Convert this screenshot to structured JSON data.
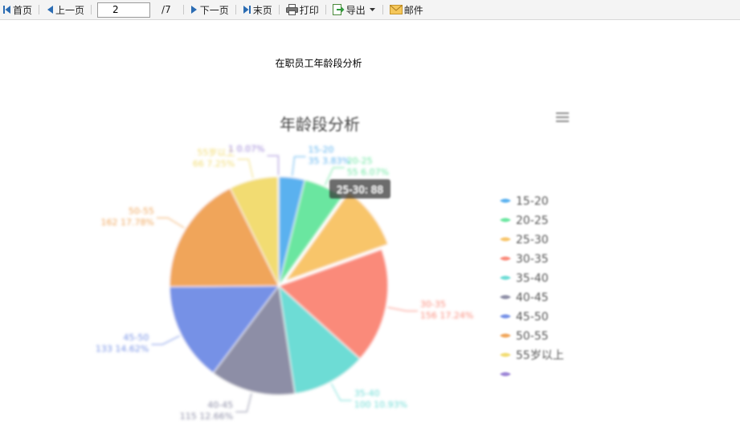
{
  "toolbar": {
    "first": "首页",
    "prev": "上一页",
    "page_value": "2",
    "page_total": "/7",
    "next": "下一页",
    "last": "末页",
    "print": "打印",
    "export": "导出",
    "mail": "邮件"
  },
  "report_title": "在职员工年龄段分析",
  "colors": {
    "15-20": "#5ab1ef",
    "20-25": "#6be6a0",
    "25-30": "#f8c56a",
    "30-35": "#fa8a7a",
    "35-40": "#6ddcd5",
    "40-45": "#8d8ea6",
    "45-50": "#7691e6",
    "50-55": "#f0a55a",
    "55岁以上": "#f2dc72",
    "unnamed": "#9b84d6"
  },
  "chart_data": {
    "type": "pie",
    "title": "年龄段分析",
    "legend_position": "right",
    "hover_tooltip": "25-30: 88",
    "categories": [
      "15-20",
      "20-25",
      "25-30",
      "30-35",
      "35-40",
      "40-45",
      "45-50",
      "50-55",
      "55岁以上",
      ""
    ],
    "values": [
      35,
      55,
      88,
      156,
      100,
      115,
      133,
      162,
      66,
      1
    ],
    "labels": [
      "15-20\n35  3.83%",
      "20-25\n55  6.07%",
      "",
      "30-35\n156  17.24%",
      "35-40\n100  10.93%",
      "40-45\n115  12.66%",
      "45-50\n133  14.62%",
      "50-55\n162  17.78%",
      "55岁以上\n66  7.25%",
      "1  0.07%"
    ]
  }
}
